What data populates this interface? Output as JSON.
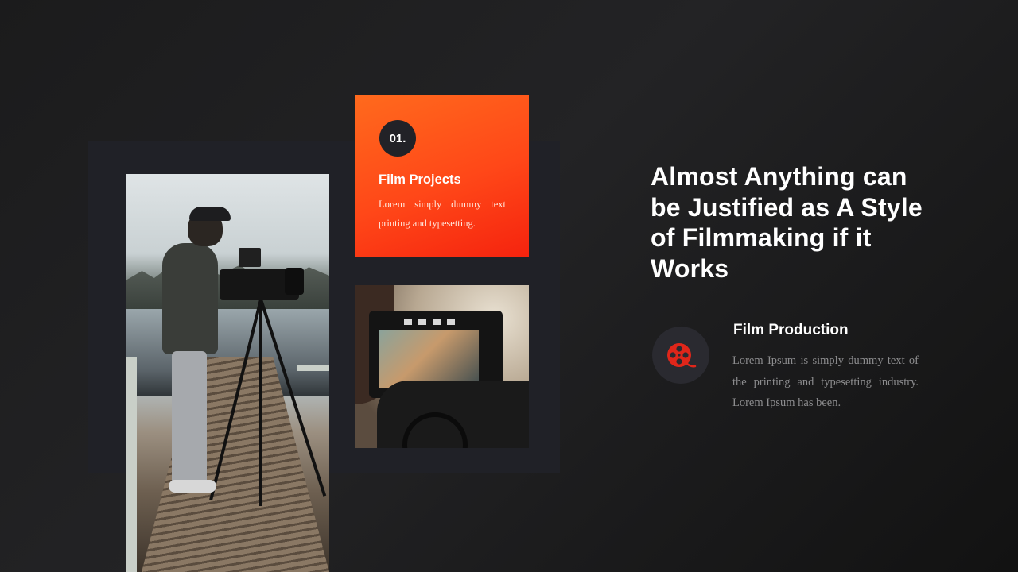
{
  "card": {
    "number": "01.",
    "title": "Film Projects",
    "text": "Lorem simply dummy text printing and typesetting."
  },
  "headline": "Almost Anything can be Justified as A Style of Filmmaking if it Works",
  "feature": {
    "icon": "film-reel-icon",
    "title": "Film Production",
    "text": "Lorem Ipsum is simply dummy text of the printing and typesetting industry.  Lorem Ipsum has been."
  },
  "colors": {
    "accent": "#ff4a17",
    "icon": "#e0261a",
    "background": "#1c1c1d",
    "panel": "#202127"
  }
}
